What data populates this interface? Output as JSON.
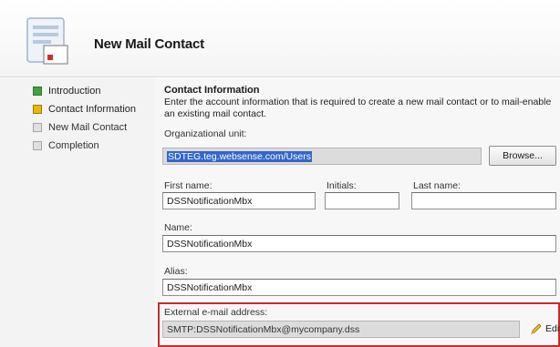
{
  "header": {
    "title": "New Mail Contact",
    "icon": "wizard-document-icon"
  },
  "steps": [
    {
      "label": "Introduction",
      "state": "done"
    },
    {
      "label": "Contact Information",
      "state": "current"
    },
    {
      "label": "New Mail Contact",
      "state": "todo"
    },
    {
      "label": "Completion",
      "state": "todo"
    }
  ],
  "content": {
    "section_title": "Contact Information",
    "description": "Enter the account information that is required to create a new mail contact or to mail-enable an existing mail contact.",
    "org_unit": {
      "label": "Organizational unit:",
      "value": "SDTEG.teg.websense.com/Users",
      "browse_label": "Browse..."
    },
    "first_name": {
      "label": "First name:",
      "value": "DSSNotificationMbx"
    },
    "initials": {
      "label": "Initials:",
      "value": ""
    },
    "last_name": {
      "label": "Last name:",
      "value": ""
    },
    "name": {
      "label": "Name:",
      "value": "DSSNotificationMbx"
    },
    "alias": {
      "label": "Alias:",
      "value": "DSSNotificationMbx"
    },
    "external_email": {
      "label": "External e-mail address:",
      "value": "SMTP:DSSNotificationMbx@mycompany.dss",
      "edit_label": "Edit..."
    }
  },
  "colors": {
    "done": "#3fa13f",
    "current": "#e8b900",
    "highlight": "#c92b2b",
    "selection": "#3366cc"
  }
}
